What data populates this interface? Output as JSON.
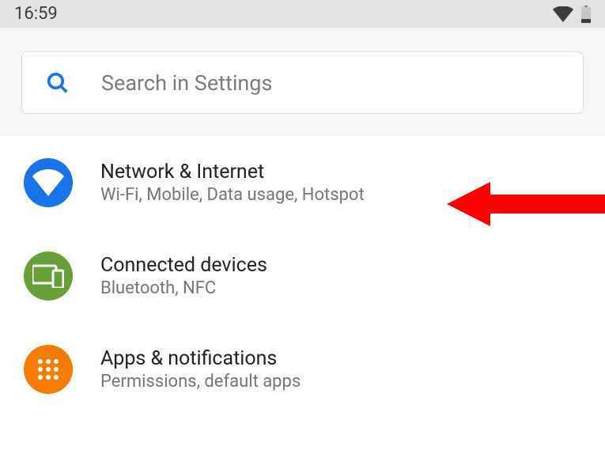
{
  "status": {
    "time": "16:59"
  },
  "search": {
    "placeholder": "Search in Settings"
  },
  "settings": {
    "items": [
      {
        "title": "Network & Internet",
        "subtitle": "Wi-Fi, Mobile, Data usage, Hotspot",
        "icon": "wifi-icon",
        "color": "#1a73e8"
      },
      {
        "title": "Connected devices",
        "subtitle": "Bluetooth, NFC",
        "icon": "devices-icon",
        "color": "#689f38"
      },
      {
        "title": "Apps & notifications",
        "subtitle": "Permissions, default apps",
        "icon": "apps-icon",
        "color": "#f57c00"
      }
    ]
  }
}
